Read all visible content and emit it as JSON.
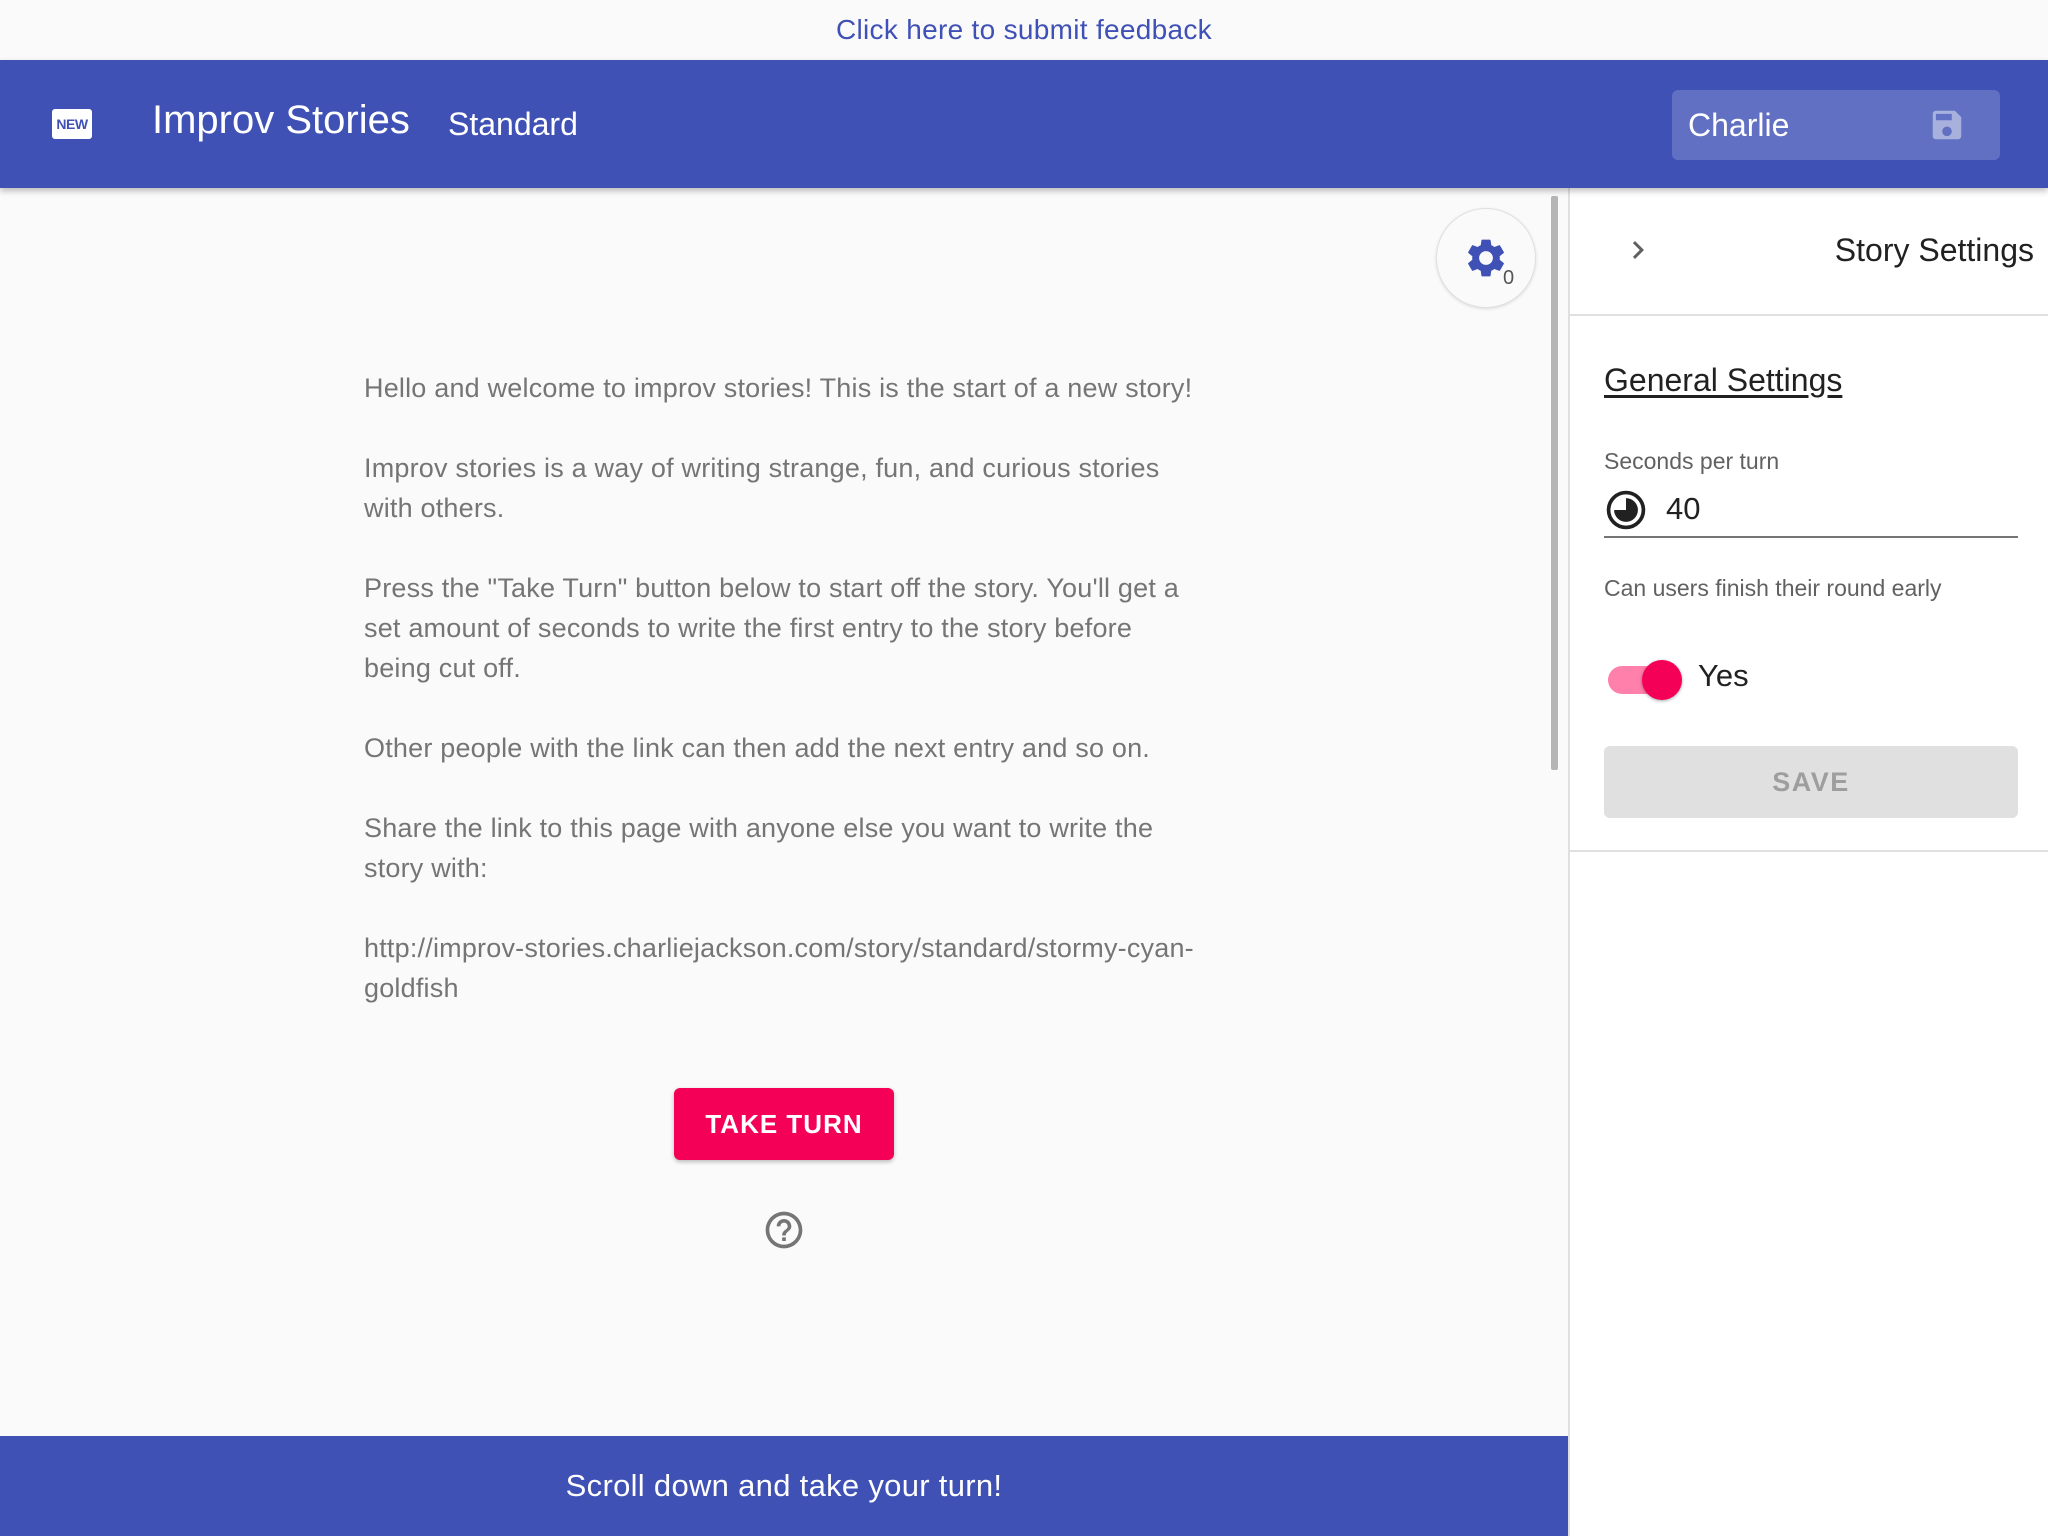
{
  "feedback": {
    "link_text": "Click here to submit feedback"
  },
  "header": {
    "logo_badge": "NEW",
    "title": "Improv Stories",
    "mode": "Standard",
    "username_value": "Charlie",
    "icons": [
      "new-releases-icon",
      "save-icon"
    ]
  },
  "main": {
    "settings_badge_count": "0",
    "paragraphs": [
      "Hello and welcome to improv stories! This is the start of a new story!",
      "Improv stories is a way of writing strange, fun, and curious stories with others.",
      "Press the \"Take Turn\" button below to start off the story. You'll get a set amount of seconds to write the first entry to the story before being cut off.",
      "Other people with the link can then add the next entry and so on.",
      "Share the link to this page with anyone else you want to write the story with:",
      "http://improv-stories.charliejackson.com/story/standard/stormy-cyan-goldfish"
    ],
    "take_turn_label": "TAKE TURN",
    "icons": [
      "gear-icon",
      "help-icon"
    ]
  },
  "bottom_bar": {
    "text": "Scroll down and take your turn!"
  },
  "settings_panel": {
    "title": "Story Settings",
    "section_heading": "General Settings",
    "seconds_label": "Seconds per turn",
    "seconds_value": "40",
    "finish_label": "Can users finish their round early",
    "finish_enabled": true,
    "finish_value_label": "Yes",
    "save_label": "SAVE",
    "icons": [
      "chevron-right-icon",
      "timer-icon"
    ]
  },
  "colors": {
    "primary": "#3f51b5",
    "accent": "#f50057"
  }
}
